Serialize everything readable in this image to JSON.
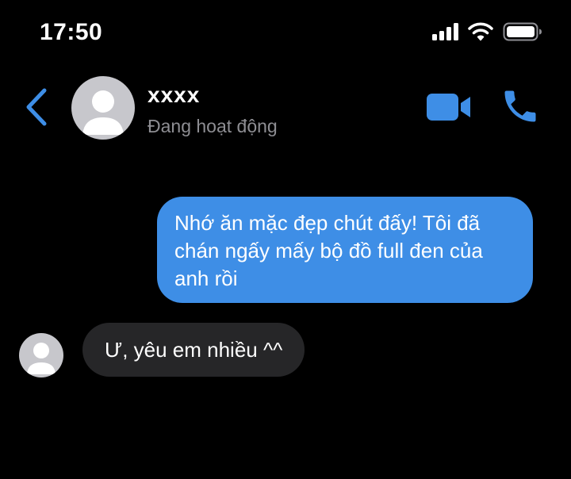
{
  "status_bar": {
    "time": "17:50"
  },
  "header": {
    "contact_name": "xxxx",
    "contact_status": "Đang hoạt động"
  },
  "messages": [
    {
      "direction": "outgoing",
      "text": "Nhớ ăn mặc đẹp chút đấy! Tôi đã chán ngấy mấy bộ đồ full đen của anh rồi"
    },
    {
      "direction": "incoming",
      "text": "Ư, yêu em nhiều ^^"
    }
  ],
  "icons": {
    "back": "chevron-left-icon",
    "video": "video-camera-icon",
    "call": "phone-icon",
    "signal": "cellular-signal-icon",
    "wifi": "wifi-icon",
    "battery": "battery-icon",
    "avatar": "default-avatar-icon"
  },
  "colors": {
    "background": "#000000",
    "accent": "#3e8ee6",
    "outgoing_bubble": "#3e8ee6",
    "incoming_bubble": "#262628",
    "secondary_text": "#8e8e93"
  }
}
